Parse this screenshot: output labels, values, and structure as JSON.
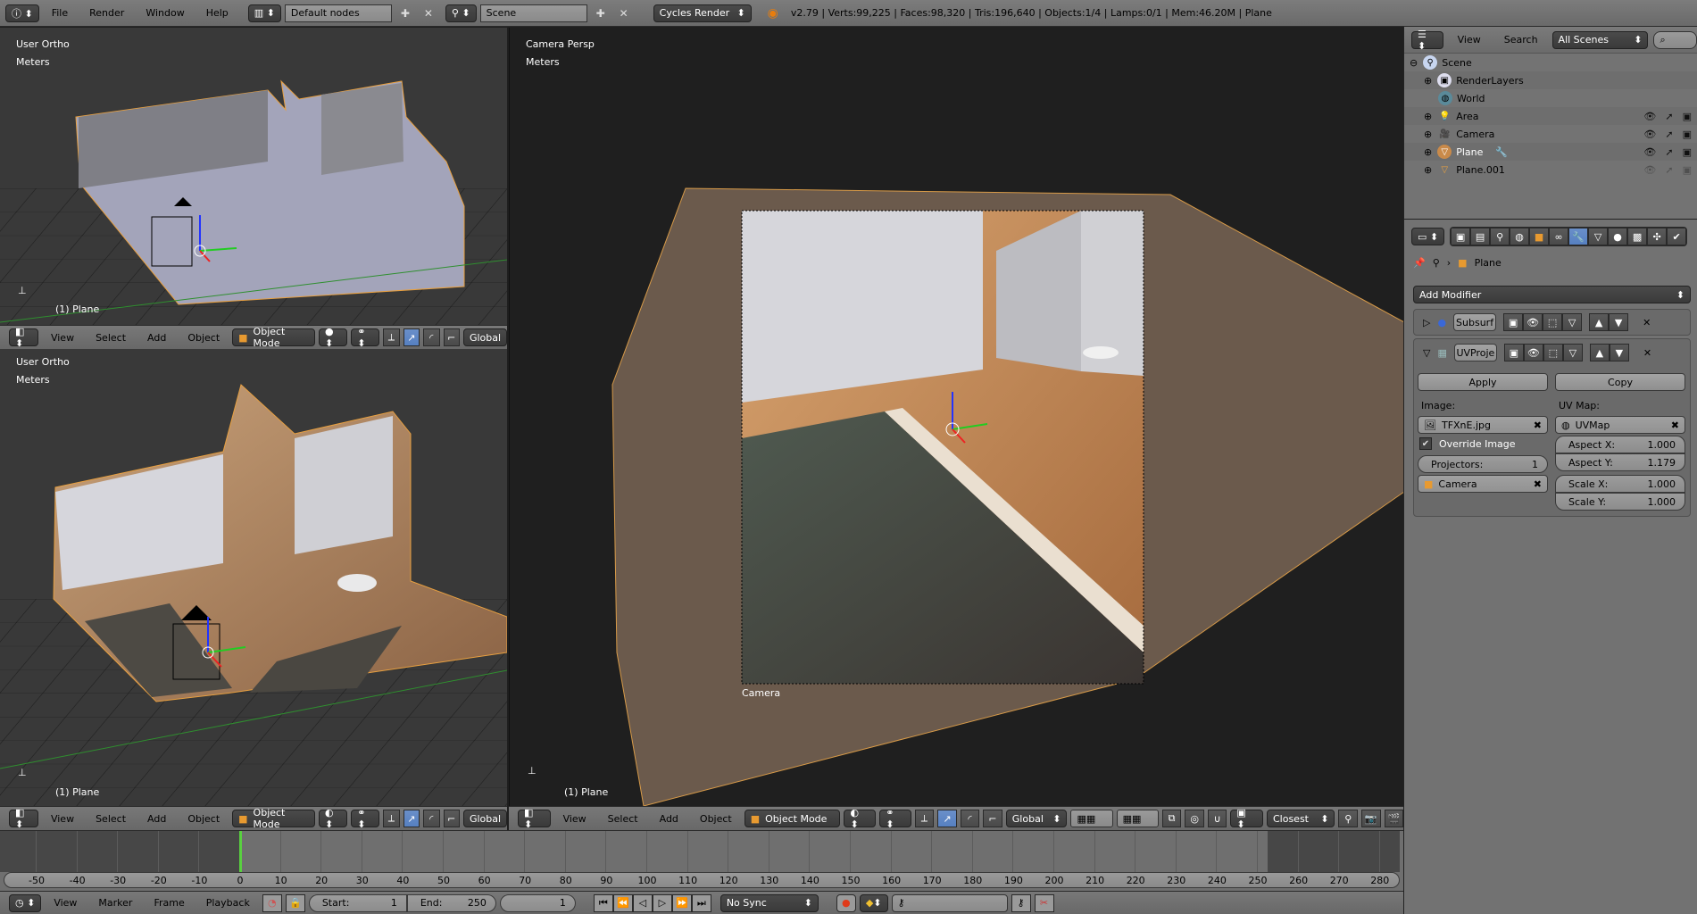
{
  "topbar": {
    "menus": [
      "File",
      "Render",
      "Window",
      "Help"
    ],
    "screen_layout": "Default nodes",
    "scene": "Scene",
    "render_engine": "Cycles Render",
    "stats": "v2.79 | Verts:99,225 | Faces:98,320 | Tris:196,640 | Objects:1/4 | Lamps:0/1 | Mem:46.20M | Plane"
  },
  "viewports": {
    "top_left": {
      "view": "User Ortho",
      "units": "Meters",
      "object": "(1) Plane"
    },
    "bottom_left": {
      "view": "User Ortho",
      "units": "Meters",
      "object": "(1) Plane"
    },
    "main": {
      "view": "Camera Persp",
      "units": "Meters",
      "object": "(1) Plane",
      "camera_label": "Camera"
    }
  },
  "view3d_header": {
    "menus": [
      "View",
      "Select",
      "Add",
      "Object"
    ],
    "mode": "Object Mode",
    "orientation": "Global",
    "snap_target": "Closest"
  },
  "outliner": {
    "menus": [
      "View",
      "Search"
    ],
    "display_mode": "All Scenes",
    "items": [
      {
        "name": "Scene",
        "depth": 0,
        "icon": "scene-icon"
      },
      {
        "name": "RenderLayers",
        "depth": 1,
        "icon": "renderlayers-icon"
      },
      {
        "name": "World",
        "depth": 1,
        "icon": "world-icon"
      },
      {
        "name": "Area",
        "depth": 1,
        "icon": "lamp-icon",
        "visible": true
      },
      {
        "name": "Camera",
        "depth": 1,
        "icon": "camera-icon",
        "visible": true
      },
      {
        "name": "Plane",
        "depth": 1,
        "icon": "mesh-icon",
        "visible": true,
        "selected": true
      },
      {
        "name": "Plane.001",
        "depth": 1,
        "icon": "mesh-icon",
        "visible": false
      }
    ]
  },
  "properties": {
    "context_object": "Plane",
    "add_modifier": "Add Modifier",
    "modifiers": [
      {
        "name": "Subsurf",
        "expanded": false
      },
      {
        "name": "UVProje",
        "expanded": true
      }
    ],
    "apply_label": "Apply",
    "copy_label": "Copy",
    "image_label": "Image:",
    "image_value": "TFXnE.jpg",
    "uvmap_label": "UV Map:",
    "uvmap_value": "UVMap",
    "override_image_label": "Override Image",
    "override_image_checked": true,
    "projectors_label": "Projectors:",
    "projectors_value": "1",
    "projector_object": "Camera",
    "aspect_x_label": "Aspect X:",
    "aspect_x_value": "1.000",
    "aspect_y_label": "Aspect Y:",
    "aspect_y_value": "1.179",
    "scale_x_label": "Scale X:",
    "scale_x_value": "1.000",
    "scale_y_label": "Scale Y:",
    "scale_y_value": "1.000"
  },
  "timeline": {
    "ticks": [
      "-50",
      "-40",
      "-30",
      "-20",
      "-10",
      "0",
      "10",
      "20",
      "30",
      "40",
      "50",
      "60",
      "70",
      "80",
      "90",
      "100",
      "110",
      "120",
      "130",
      "140",
      "150",
      "160",
      "170",
      "180",
      "190",
      "200",
      "210",
      "220",
      "230",
      "240",
      "250",
      "260",
      "270",
      "280"
    ],
    "current_frame_marker": 0,
    "menus": [
      "View",
      "Marker",
      "Frame",
      "Playback"
    ],
    "start_label": "Start:",
    "start_value": "1",
    "end_label": "End:",
    "end_value": "250",
    "current_frame": "1",
    "sync": "No Sync"
  }
}
